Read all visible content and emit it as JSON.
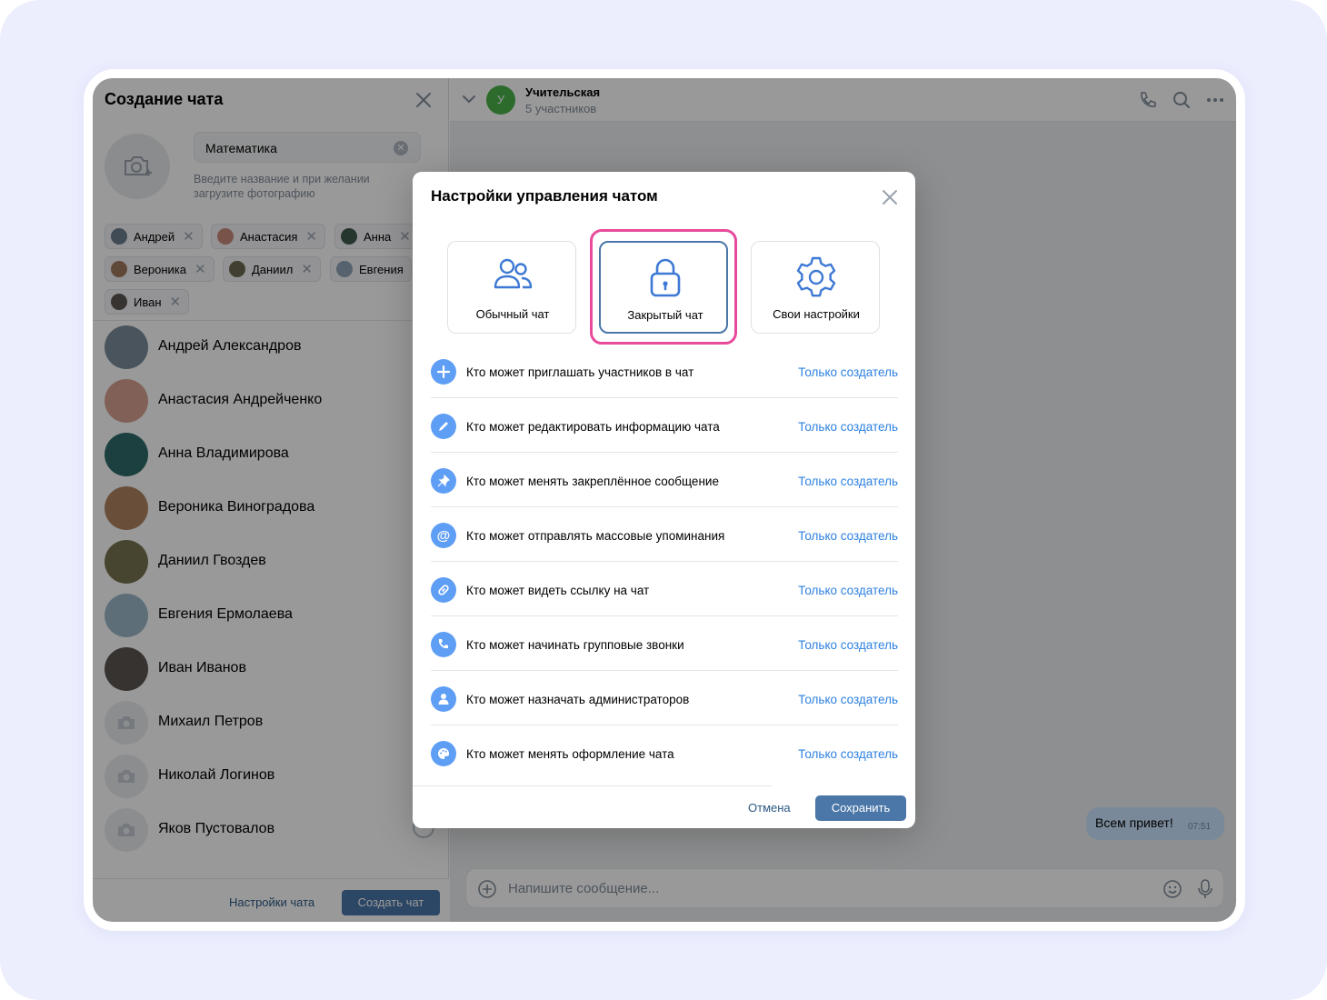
{
  "left": {
    "title": "Создание чата",
    "chat_name_value": "Математика",
    "hint": "Введите название и при желании загрузите фотографию",
    "chips": [
      {
        "label": "Андрей",
        "color": "#6b7d8f"
      },
      {
        "label": "Анастасия",
        "color": "#c98a7a"
      },
      {
        "label": "Анна",
        "color": "#3f5a4f"
      },
      {
        "label": "Вероника",
        "color": "#a0785e"
      },
      {
        "label": "Даниил",
        "color": "#6d6a52"
      },
      {
        "label": "Евгения",
        "color": "#8fa6b7"
      },
      {
        "label": "Иван",
        "color": "#5b5550"
      }
    ],
    "contacts": [
      {
        "name": "Андрей Александров",
        "color": "#7b8d9a"
      },
      {
        "name": "Анастасия Андрейченко",
        "color": "#d8a291"
      },
      {
        "name": "Анна Владимирова",
        "color": "#2f6b6a"
      },
      {
        "name": "Вероника Виноградова",
        "color": "#b08461"
      },
      {
        "name": "Даниил Гвоздев",
        "color": "#77744f"
      },
      {
        "name": "Евгения Ермолаева",
        "color": "#9cb8c8"
      },
      {
        "name": "Иван Иванов",
        "color": "#5d5652"
      },
      {
        "name": "Михаил Петров",
        "color": ""
      },
      {
        "name": "Николай Логинов",
        "color": ""
      },
      {
        "name": "Яков Пустовалов",
        "color": ""
      }
    ],
    "settings_link": "Настройки чата",
    "create_button": "Создать чат"
  },
  "right": {
    "chat_initial": "У",
    "chat_title": "Учительская",
    "chat_subtitle": "5 участников",
    "message_text": "Всем привет!",
    "message_time": "07:51",
    "composer_placeholder": "Напишите сообщение..."
  },
  "modal": {
    "title": "Настройки управления чатом",
    "modes": [
      {
        "label": "Обычный чат",
        "icon": "users-icon",
        "selected": false
      },
      {
        "label": "Закрытый чат",
        "icon": "lock-icon",
        "selected": true
      },
      {
        "label": "Свои настройки",
        "icon": "gear-icon",
        "selected": false
      }
    ],
    "permissions": [
      {
        "icon": "plus-icon",
        "text": "Кто может приглашать участников в чат",
        "value": "Только создатель"
      },
      {
        "icon": "pencil-icon",
        "text": "Кто может редактировать информацию чата",
        "value": "Только создатель"
      },
      {
        "icon": "pin-icon",
        "text": "Кто может менять закреплённое сообщение",
        "value": "Только создатель"
      },
      {
        "icon": "at-icon",
        "text": "Кто может отправлять массовые упоминания",
        "value": "Только создатель"
      },
      {
        "icon": "link-icon",
        "text": "Кто может видеть ссылку на чат",
        "value": "Только создатель"
      },
      {
        "icon": "phone-icon",
        "text": "Кто может начинать групповые звонки",
        "value": "Только создатель"
      },
      {
        "icon": "user-icon",
        "text": "Кто может назначать администраторов",
        "value": "Только создатель"
      },
      {
        "icon": "palette-icon",
        "text": "Кто может менять оформление чата",
        "value": "Только создатель"
      }
    ],
    "cancel_label": "Отмена",
    "save_label": "Сохранить"
  },
  "colors": {
    "accent": "#4a76a8",
    "link": "#2d81e0",
    "highlight": "#e84a9c",
    "permission_icon_bg": "#5f9ef5",
    "page_bg": "#eceefe"
  }
}
